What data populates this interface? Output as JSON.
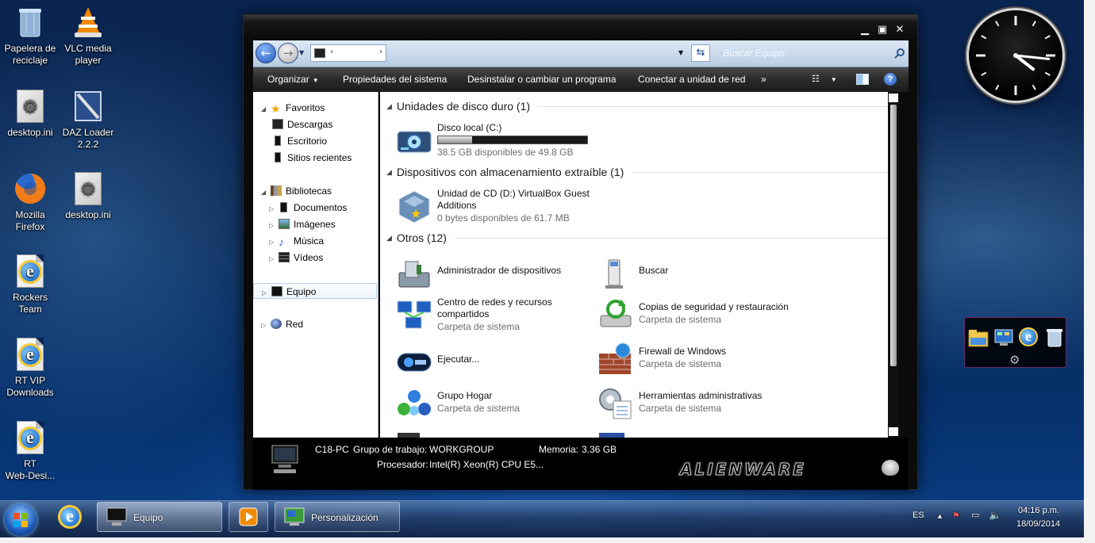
{
  "desktop": {
    "icons": [
      {
        "label_l1": "Papelera de",
        "label_l2": "reciclaje"
      },
      {
        "label_l1": "VLC media",
        "label_l2": "player"
      },
      {
        "label_l1": "desktop.ini",
        "label_l2": ""
      },
      {
        "label_l1": "DAZ Loader",
        "label_l2": "2.2.2"
      },
      {
        "label_l1": "Mozilla",
        "label_l2": "Firefox"
      },
      {
        "label_l1": "desktop.ini",
        "label_l2": ""
      },
      {
        "label_l1": "Rockers",
        "label_l2": "Team"
      },
      {
        "label_l1": "RT VIP",
        "label_l2": "Downloads"
      },
      {
        "label_l1": "RT",
        "label_l2": "Web-Desi..."
      }
    ]
  },
  "window": {
    "search_placeholder": "Buscar Equipo",
    "toolbar": {
      "organize": "Organizar",
      "system_properties": "Propiedades del sistema",
      "uninstall": "Desinstalar o cambiar un programa",
      "map_drive": "Conectar a unidad de red",
      "more": "»"
    },
    "nav": {
      "favorites": "Favoritos",
      "downloads": "Descargas",
      "desktop": "Escritorio",
      "recent": "Sitios recientes",
      "libraries": "Bibliotecas",
      "documents": "Documentos",
      "images": "Imágenes",
      "music": "Música",
      "videos": "Vídeos",
      "computer": "Equipo",
      "network": "Red"
    },
    "groups": {
      "hdd": "Unidades de disco duro (1)",
      "removable": "Dispositivos con almacenamiento extraíble (1)",
      "others": "Otros (12)"
    },
    "drive_c": {
      "name": "Disco local (C:)",
      "free": "38.5 GB disponibles de 49.8 GB",
      "used_fraction": 0.227
    },
    "drive_d": {
      "name_l1": "Unidad de CD (D:) VirtualBox Guest",
      "name_l2": "Additions",
      "free": "0 bytes disponibles de 61.7 MB"
    },
    "others": [
      {
        "name": "Administrador de dispositivos",
        "sub": ""
      },
      {
        "name": "Buscar",
        "sub": ""
      },
      {
        "name": "Centro de redes y recursos",
        "name_l2": "compartidos",
        "sub": "Carpeta de sistema"
      },
      {
        "name": "Copias de seguridad y restauración",
        "sub": "Carpeta de sistema"
      },
      {
        "name": "Ejecutar...",
        "sub": ""
      },
      {
        "name": "Firewall de Windows",
        "sub": "Carpeta de sistema"
      },
      {
        "name": "Grupo Hogar",
        "sub": "Carpeta de sistema"
      },
      {
        "name": "Herramientas administrativas",
        "sub": "Carpeta de sistema"
      }
    ],
    "details": {
      "pc_name": "C18-PC",
      "workgroup_label": "Grupo de trabajo:",
      "workgroup": "WORKGROUP",
      "memory_label": "Memoria:",
      "memory": "3.36 GB",
      "cpu_label": "Procesador:",
      "cpu": "Intel(R) Xeon(R) CPU E5...",
      "brand": "ALIENWARE"
    }
  },
  "taskbar": {
    "equipo": "Equipo",
    "personalizacion": "Personalización",
    "lang": "ES",
    "time": "04:16 p.m.",
    "date": "18/09/2014"
  },
  "clock_time": {
    "hour": 4,
    "minute": 16
  }
}
